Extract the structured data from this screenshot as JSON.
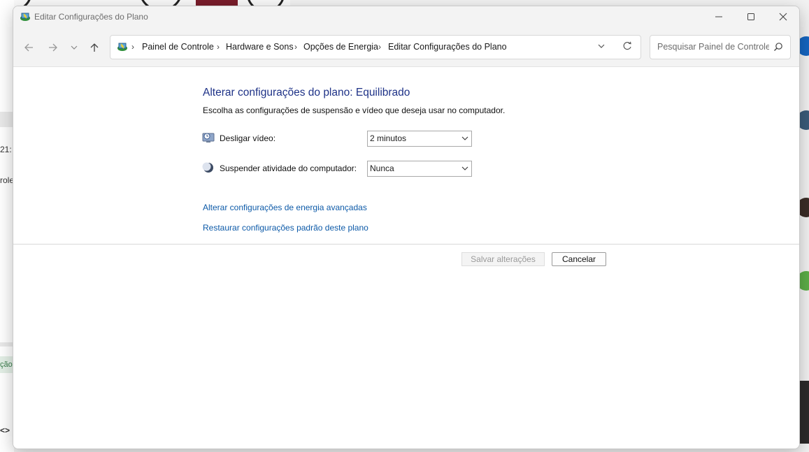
{
  "window": {
    "title": "Editar Configurações do Plano",
    "controls": {
      "minimize": "minimize-icon",
      "maximize": "maximize-icon",
      "close": "close-icon"
    }
  },
  "nav": {
    "back": "back-arrow-icon",
    "forward": "forward-arrow-icon",
    "recent": "chevron-down-icon",
    "up": "up-arrow-icon"
  },
  "breadcrumb": [
    "Painel de Controle",
    "Hardware e Sons",
    "Opções de Energia",
    "Editar Configurações do Plano"
  ],
  "search": {
    "placeholder": "Pesquisar Painel de Controle"
  },
  "main": {
    "heading": "Alterar configurações do plano: Equilibrado",
    "subtitle": "Escolha as configurações de suspensão e vídeo que deseja usar no computador.",
    "settings": [
      {
        "label": "Desligar vídeo:",
        "value": "2 minutos",
        "icon": "display-clock-icon"
      },
      {
        "label": "Suspender atividade do computador:",
        "value": "Nunca",
        "icon": "moon-icon"
      }
    ],
    "links": [
      "Alterar configurações de energia avançadas",
      "Restaurar configurações padrão deste plano"
    ],
    "buttons": {
      "save": "Salvar alterações",
      "cancel": "Cancelar"
    }
  },
  "background": {
    "left_fragments": [
      "21:",
      "role",
      "ção",
      "<>"
    ]
  },
  "colors": {
    "heading": "#1e3287",
    "link": "#0d5aa8",
    "titlebar": "#f3f3f3",
    "disabled_text": "#9a9a9a"
  }
}
